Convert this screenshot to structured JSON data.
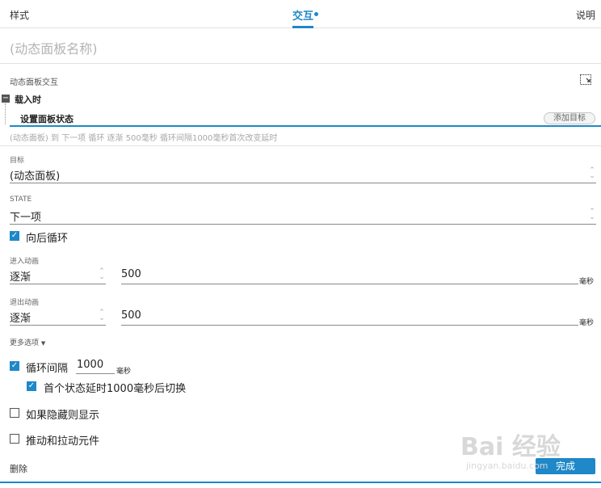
{
  "tabs": [
    {
      "label": "样式"
    },
    {
      "label": "交互"
    },
    {
      "label": "说明"
    }
  ],
  "panel_name_placeholder": "(动态面板名称)",
  "interactions_header": "动态面板交互",
  "event": {
    "name": "载入时",
    "action": "设置面板状态",
    "add_target_label": "添加目标",
    "summary": "(动态面板) 到 下一项 循环 逐渐 500毫秒 循环间隔1000毫秒首次改变延时"
  },
  "target": {
    "label": "目标",
    "value": "(动态面板)"
  },
  "state": {
    "label": "STATE",
    "value": "下一项"
  },
  "wrap": {
    "label": "向后循环",
    "checked": true
  },
  "enter_animation": {
    "label": "进入动画",
    "type": "逐渐",
    "duration": "500",
    "unit": "毫秒"
  },
  "exit_animation": {
    "label": "退出动画",
    "type": "逐渐",
    "duration": "500",
    "unit": "毫秒"
  },
  "more_options": {
    "label": "更多选项"
  },
  "loop_interval": {
    "label": "循环间隔",
    "value": "1000",
    "unit": "毫秒",
    "checked": true
  },
  "first_delay": {
    "label": "首个状态延时1000毫秒后切换",
    "checked": true
  },
  "show_if_hidden": {
    "label": "如果隐藏则显示",
    "checked": false
  },
  "push_pull": {
    "label": "推动和拉动元件",
    "checked": false
  },
  "footer": {
    "delete_label": "删除",
    "done_label": "完成"
  },
  "watermark": {
    "brand": "Bai  经验",
    "url": "jingyan.baidu.com"
  },
  "colors": {
    "accent": "#1e88c8",
    "placeholder": "#b4b4b4"
  }
}
